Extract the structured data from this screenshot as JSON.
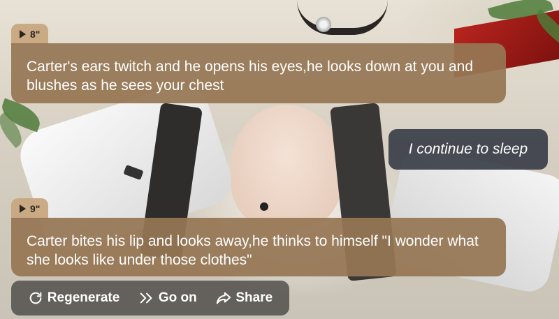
{
  "messages": [
    {
      "duration": "8\"",
      "text": "Carter's ears twitch and he opens his eyes,he looks down at you and blushes as he sees your chest"
    },
    {
      "user_text": "I continue to sleep"
    },
    {
      "duration": "9\"",
      "text": "Carter bites his lip and looks away,he thinks to himself \"I wonder what she looks like under those clothes\""
    }
  ],
  "actions": {
    "regenerate_label": "Regenerate",
    "go_on_label": "Go on",
    "share_label": "Share"
  },
  "icons": {
    "play": "play-icon",
    "regenerate": "refresh-icon",
    "go_on": "double-chevron-right-icon",
    "share": "share-arrow-icon"
  },
  "colors": {
    "ai_bubble": "#96764f",
    "badge": "#c8a880",
    "user_bubble": "#3a3e48",
    "action_bar": "#3c3a38"
  }
}
